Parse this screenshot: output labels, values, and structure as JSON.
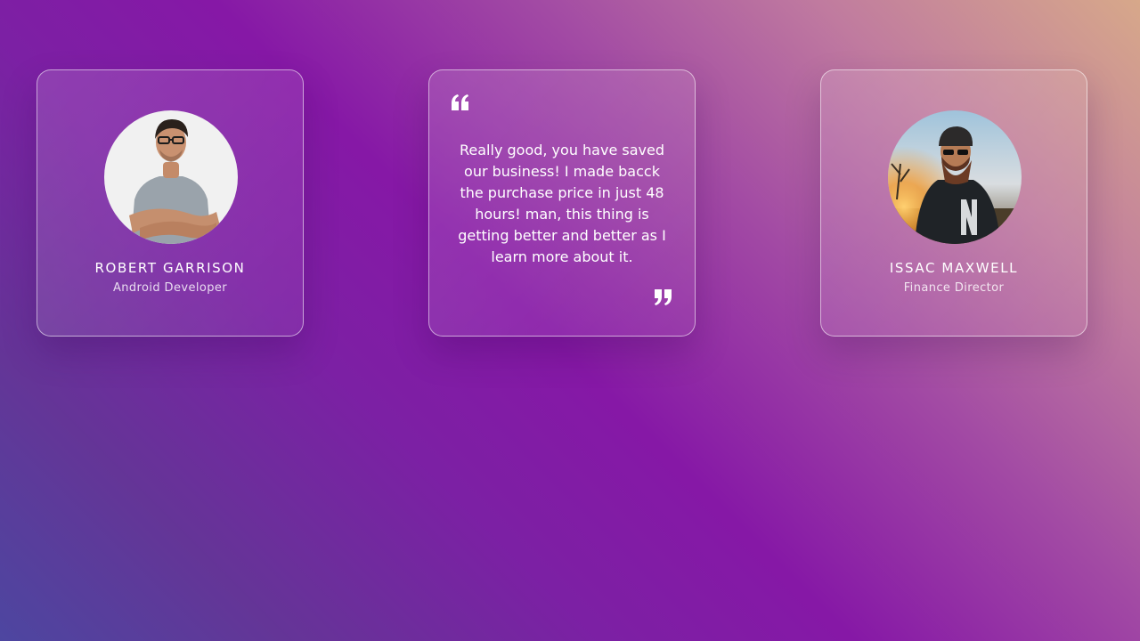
{
  "testimonials": {
    "left": {
      "name": "ROBERT GARRISON",
      "role": "Android Developer",
      "avatar_icon": "portrait-man-glasses"
    },
    "middle": {
      "quote": "Really good, you have saved our business! I made bacck the purchase price in just 48 hours! man, this thing is getting better and better as I learn more about it.",
      "open_icon": "quote-open-icon",
      "close_icon": "quote-close-icon"
    },
    "right": {
      "name": "ISSAC MAXWELL",
      "role": "Finance Director",
      "avatar_icon": "portrait-man-sunset"
    }
  },
  "colors": {
    "background_start": "#4d46a0",
    "background_mid": "#8618a6",
    "background_end": "#d7a88a",
    "card_border": "#ffffff"
  }
}
